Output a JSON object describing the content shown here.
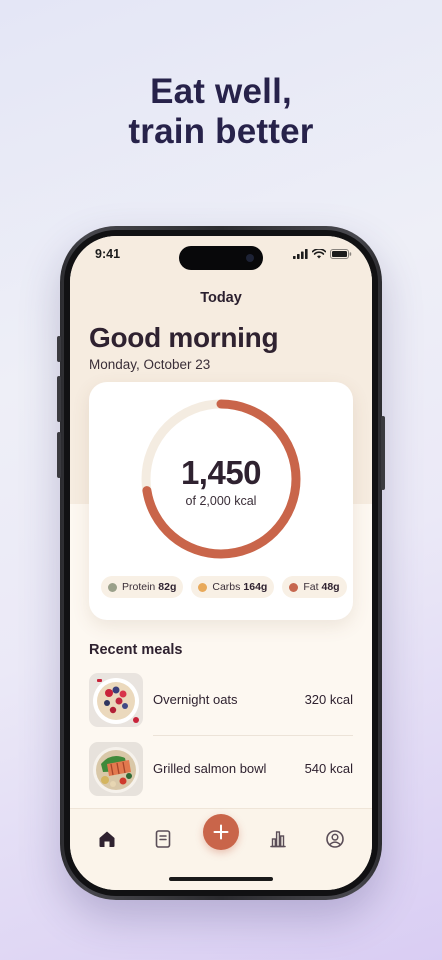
{
  "headline": {
    "line1": "Eat well,",
    "line2": "train better"
  },
  "status": {
    "time": "9:41"
  },
  "nav": {
    "title": "Today"
  },
  "greeting": {
    "title": "Good morning",
    "date": "Monday, October 23"
  },
  "calories": {
    "consumed": "1,450",
    "goal_text": "of 2,000 kcal",
    "progress_fraction": 0.725
  },
  "macros": [
    {
      "label": "Protein",
      "value": "82g",
      "color": "#9aa08a"
    },
    {
      "label": "Carbs",
      "value": "164g",
      "color": "#e8a95a"
    },
    {
      "label": "Fat",
      "value": "48g",
      "color": "#c6674f"
    }
  ],
  "recent": {
    "title": "Recent meals",
    "items": [
      {
        "name": "Overnight oats",
        "kcal": "320 kcal",
        "image": "oats-bowl"
      },
      {
        "name": "Grilled salmon bowl",
        "kcal": "540 kcal",
        "image": "salmon-bowl"
      }
    ]
  },
  "tabs": [
    {
      "name": "home-icon",
      "active": true
    },
    {
      "name": "journal-icon",
      "active": false
    },
    {
      "name": "add-icon",
      "active": false
    },
    {
      "name": "stats-icon",
      "active": false
    },
    {
      "name": "profile-icon",
      "active": false
    }
  ],
  "colors": {
    "accent": "#c9654a",
    "ring_track": "#f4ece1",
    "headline": "#27224a"
  }
}
